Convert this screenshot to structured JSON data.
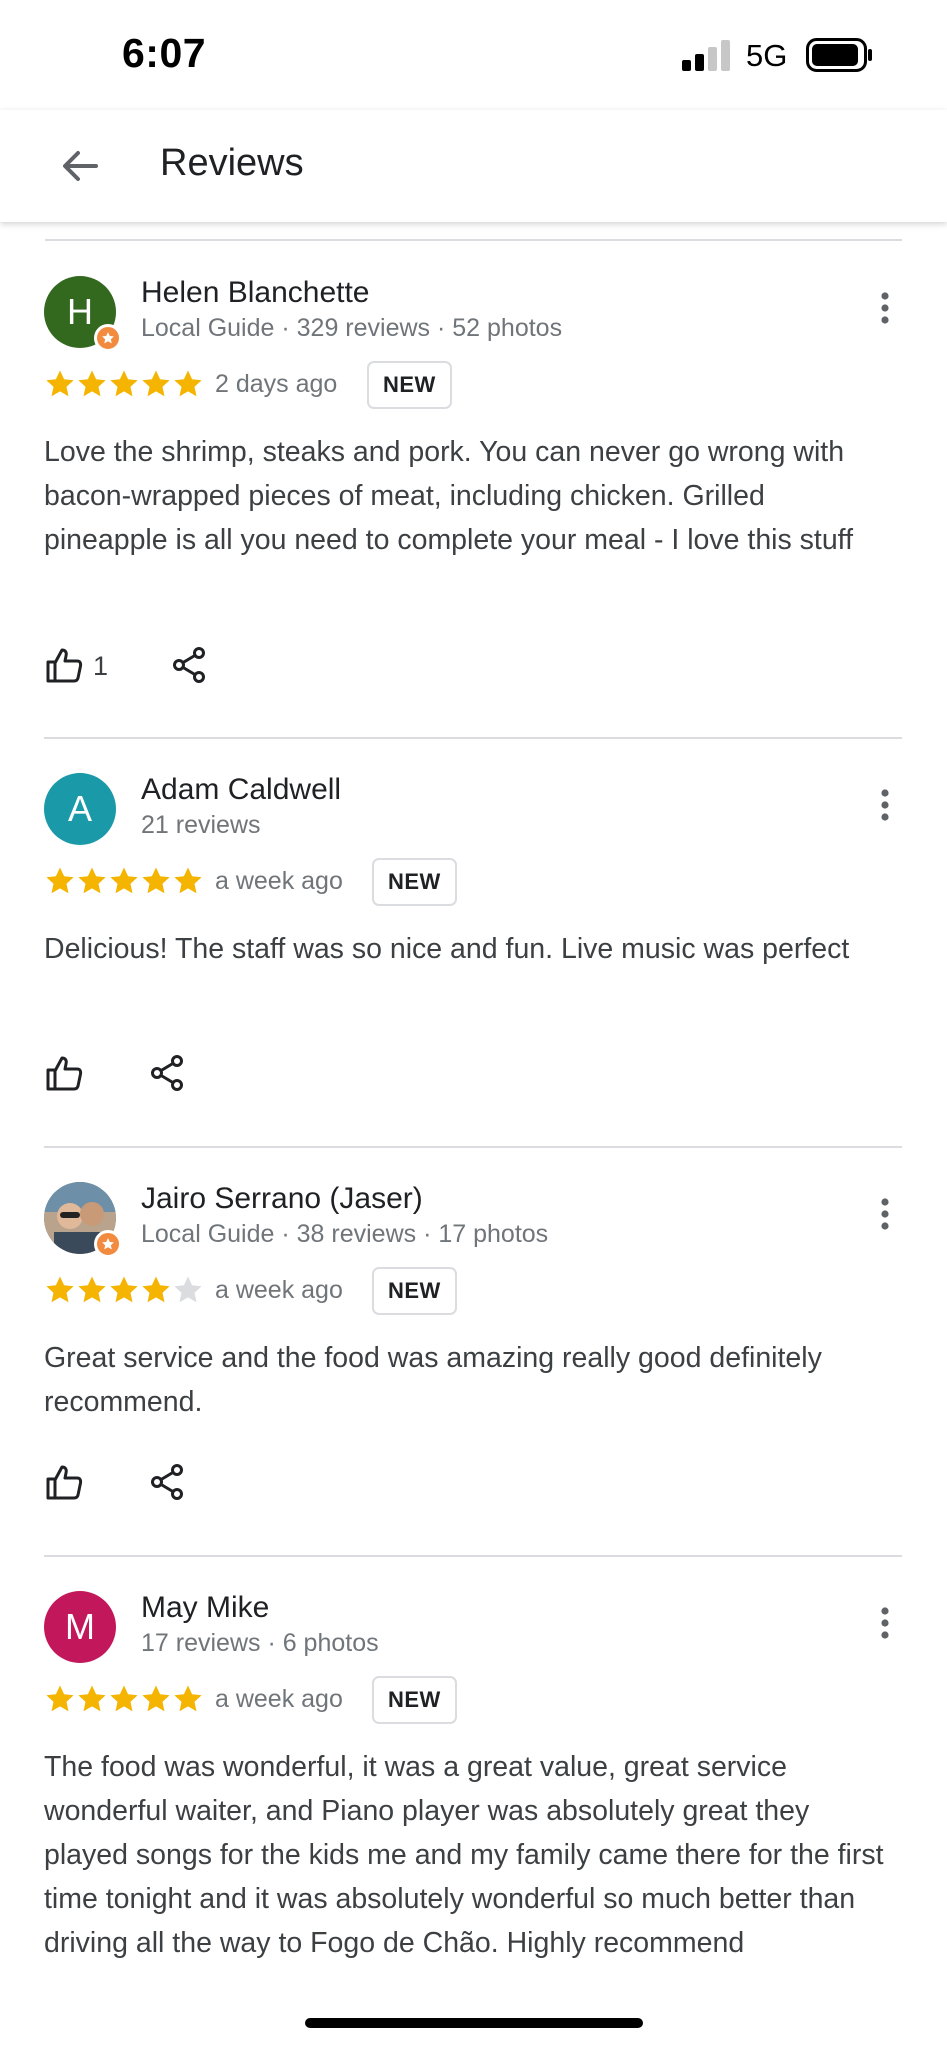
{
  "status_bar": {
    "time": "6:07",
    "network": "5G"
  },
  "header": {
    "title": "Reviews",
    "back_icon": "arrow-left-icon"
  },
  "colors": {
    "star": "#f4b400",
    "star_empty": "#dadce0",
    "accent_badge": "#f28b40"
  },
  "reviews": [
    {
      "initial": "H",
      "avatar_color": "#33691e",
      "local_guide": true,
      "name": "Helen Blanchette",
      "meta": "Local Guide · 329 reviews · 52 photos",
      "rating": 5,
      "when": "2 days ago",
      "badge": "NEW",
      "text": "Love the shrimp, steaks and pork. You can never go wrong with bacon-wrapped pieces of meat, including chicken.  Grilled pineapple is all you need to complete your meal - I love this stuff",
      "likes": "1"
    },
    {
      "initial": "A",
      "avatar_color": "#1a9aa8",
      "local_guide": false,
      "name": "Adam Caldwell",
      "meta": "21 reviews",
      "rating": 5,
      "when": "a week ago",
      "badge": "NEW",
      "text": "Delicious! The staff was so nice and fun. Live music was perfect",
      "likes": ""
    },
    {
      "initial": "",
      "avatar_color": "#8d7b6a",
      "local_guide": true,
      "name": "Jairo Serrano (Jaser)",
      "meta": "Local Guide · 38 reviews · 17 photos",
      "rating": 4,
      "when": "a week ago",
      "badge": "NEW",
      "text": "Great service and the food was amazing really good definitely recommend.",
      "likes": ""
    },
    {
      "initial": "M",
      "avatar_color": "#c2185b",
      "local_guide": false,
      "name": "May Mike",
      "meta": "17 reviews · 6 photos",
      "rating": 5,
      "when": "a week ago",
      "badge": "NEW",
      "text": "The food was wonderful, it was a great value, great service wonderful waiter, and Piano player was absolutely great they played songs for the kids me and my family came there for the first time tonight and it was absolutely wonderful so much better than driving all the way to Fogo de Chão. Highly  recommend",
      "likes": ""
    }
  ]
}
